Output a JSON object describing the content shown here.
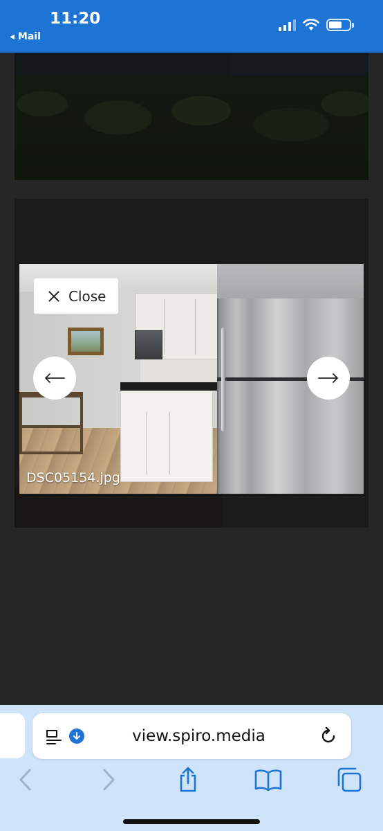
{
  "status_bar": {
    "time": "11:20",
    "back_app_label": "◂ Mail",
    "accent_color": "#1e74d4"
  },
  "lightbox": {
    "close_label": "Close",
    "filename": "DSC05154.jpg",
    "prev_icon": "arrow-left-icon",
    "next_icon": "arrow-right-icon"
  },
  "browser": {
    "url": "view.spiro.media",
    "icons": [
      "reader-icon",
      "download-icon",
      "reload-icon",
      "back-icon",
      "forward-icon",
      "share-icon",
      "bookmarks-icon",
      "tabs-icon"
    ]
  }
}
